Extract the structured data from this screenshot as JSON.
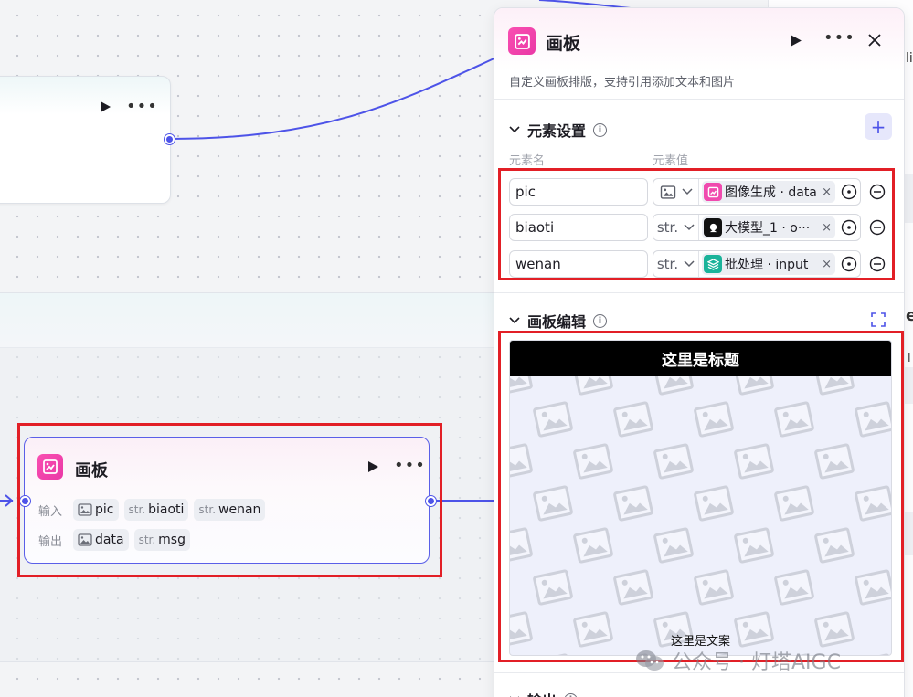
{
  "canvas": {
    "top_node": {
      "title": ""
    },
    "canvas_node": {
      "title": "画板",
      "input_label": "输入",
      "output_label": "输出",
      "inputs": [
        {
          "type": "image",
          "name": "pic"
        },
        {
          "type": "str.",
          "name": "biaoti"
        },
        {
          "type": "str.",
          "name": "wenan"
        }
      ],
      "outputs": [
        {
          "type": "image",
          "name": "data"
        },
        {
          "type": "str.",
          "name": "msg"
        }
      ]
    }
  },
  "panel": {
    "title": "画板",
    "description": "自定义画板排版，支持引用添加文本和图片",
    "elements_section": {
      "title": "元素设置",
      "col_name": "元素名",
      "col_value": "元素值",
      "rows": [
        {
          "name": "pic",
          "type": "image",
          "ref": "图像生成 · data",
          "ref_color": "#f04aae"
        },
        {
          "name": "biaoti",
          "type": "str.",
          "ref": "大模型_1 · o···",
          "ref_color": "#111111"
        },
        {
          "name": "wenan",
          "type": "str.",
          "ref": "批处理 · input",
          "ref_color": "#1bb39a"
        }
      ]
    },
    "board_section": {
      "title": "画板编辑",
      "board_title": "这里是标题",
      "board_text": "这里是文案"
    },
    "output_section": {
      "title": "输出"
    }
  },
  "peek": {
    "fragment_top": "li",
    "fragment_mid": "e",
    "fragment_low": "l"
  },
  "watermark": {
    "text": "公众号 · 灯塔AIGC"
  },
  "colors": {
    "accent": "#4d53e8",
    "highlight": "#e21f26",
    "brand_pink": "#f04aae"
  }
}
